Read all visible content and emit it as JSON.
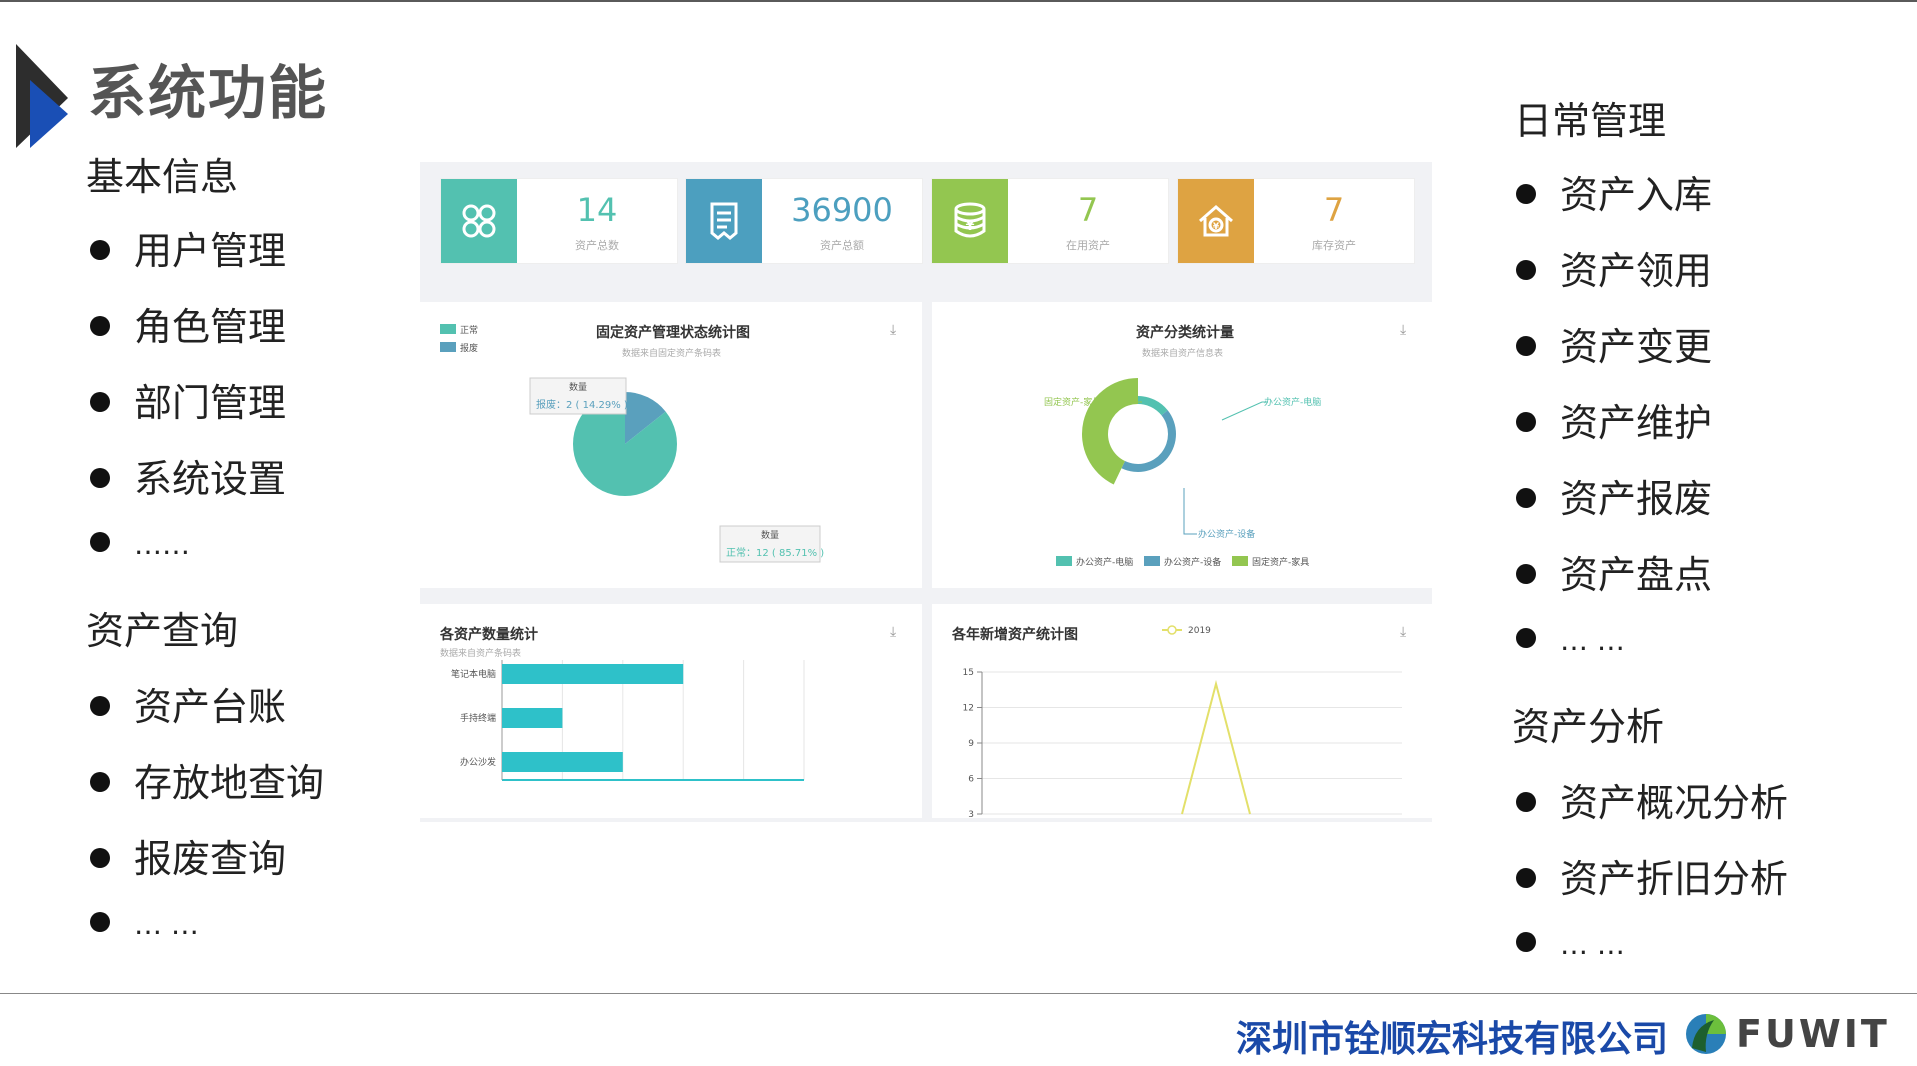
{
  "slide": {
    "title": "系统功能",
    "left_sections": [
      {
        "title": "基本信息",
        "items": [
          "用户管理",
          "角色管理",
          "部门管理",
          "系统设置",
          "……"
        ]
      },
      {
        "title": "资产查询",
        "items": [
          "资产台账",
          "存放地查询",
          "报废查询",
          "…   …"
        ]
      }
    ],
    "right_sections": [
      {
        "title": "日常管理",
        "items": [
          "资产入库",
          "资产领用",
          "资产变更",
          "资产维护",
          "资产报废",
          "资产盘点",
          "…   …"
        ]
      },
      {
        "title": "资产分析",
        "items": [
          "资产概况分析",
          "资产折旧分析",
          "…   …"
        ]
      }
    ],
    "company": "深圳市铨顺宏科技有限公司",
    "brand": "FUWIT"
  },
  "dashboard": {
    "kpis": [
      {
        "value": "14",
        "label": "资产总数",
        "color": "#53c1b0",
        "icon": "grid-clover-icon"
      },
      {
        "value": "36900",
        "label": "资产总额",
        "color": "#4c9fbf",
        "icon": "document-icon"
      },
      {
        "value": "7",
        "label": "在用资产",
        "color": "#93c650",
        "icon": "money-stack-icon"
      },
      {
        "value": "7",
        "label": "库存资产",
        "color": "#dea342",
        "icon": "home-yen-icon"
      }
    ],
    "status_pie": {
      "title": "固定资产管理状态统计图",
      "subtitle": "数据来自固定资产条码表",
      "legend": [
        "正常",
        "报废"
      ],
      "tooltip_head": "数量",
      "tooltip_scrap": "报废：2 ( 14.29% )",
      "tooltip_normal": "正常：12 ( 85.71% )"
    },
    "category_donut": {
      "title": "资产分类统计量",
      "subtitle": "数据来自资产信息表",
      "labels": [
        "固定资产-家具",
        "办公资产-电脑",
        "办公资产-设备"
      ],
      "legend": [
        "办公资产-电脑",
        "办公资产-设备",
        "固定资产-家具"
      ]
    },
    "count_bar": {
      "title": "各资产数量统计",
      "subtitle": "数据来自资产条码表"
    },
    "yearly_line": {
      "title": "各年新增资产统计图",
      "legend": "2019"
    }
  },
  "chart_data": [
    {
      "type": "pie",
      "title": "固定资产管理状态统计图",
      "categories": [
        "正常",
        "报废"
      ],
      "values": [
        12,
        2
      ],
      "colors": [
        "#53c1b0",
        "#5aa0bd"
      ]
    },
    {
      "type": "pie",
      "title": "资产分类统计量",
      "categories": [
        "办公资产-电脑",
        "办公资产-设备",
        "固定资产-家具"
      ],
      "values": [
        2,
        6,
        6
      ],
      "colors": [
        "#53c1b0",
        "#5aa0bd",
        "#93c650"
      ]
    },
    {
      "type": "bar",
      "title": "各资产数量统计",
      "categories": [
        "笔记本电脑",
        "手持终端",
        "办公沙发"
      ],
      "values": [
        6,
        2,
        4
      ],
      "xlim": [
        0,
        10
      ],
      "color": "#2ec1c9"
    },
    {
      "type": "line",
      "title": "各年新增资产统计图",
      "series": [
        {
          "name": "2019",
          "x": [
            0,
            1,
            2
          ],
          "y": [
            3,
            14,
            3
          ]
        }
      ],
      "yticks": [
        3,
        6,
        9,
        12,
        15
      ],
      "ylim": [
        3,
        15
      ],
      "color": "#e3e06a"
    }
  ]
}
